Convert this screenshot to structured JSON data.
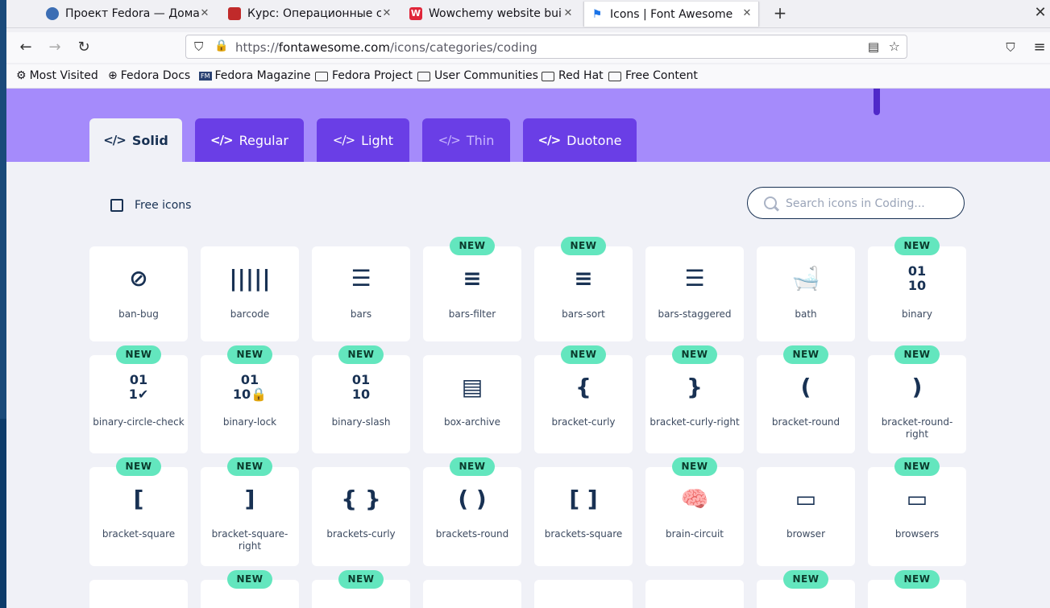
{
  "browser": {
    "tabs": [
      {
        "title": "Проект Fedora — Домашн",
        "favicon_color": "#3c6eb4"
      },
      {
        "title": "Курс: Операционные сис",
        "favicon_color": "#c02a2a"
      },
      {
        "title": "Wowchemy website build",
        "favicon_color": "#e0263a"
      },
      {
        "title": "Icons | Font Awesome",
        "favicon_color": "#1a73e8"
      }
    ],
    "new_tab": "+",
    "close_window": "✕",
    "url_scheme": "https://",
    "url_host": "fontawesome.com",
    "url_path": "/icons/categories/coding",
    "bookmarks": [
      "Most Visited",
      "Fedora Docs",
      "Fedora Magazine",
      "Fedora Project",
      "User Communities",
      "Red Hat",
      "Free Content"
    ]
  },
  "style_tabs": [
    "Solid",
    "Regular",
    "Light",
    "Thin",
    "Duotone"
  ],
  "code_glyph": "</>",
  "free_icons_label": "Free icons",
  "search_placeholder": "Search icons in Coding...",
  "badge_text": "NEW",
  "icons": [
    {
      "name": "ban-bug",
      "glyph": "⊘",
      "new": false
    },
    {
      "name": "barcode",
      "glyph": "|||||",
      "new": false
    },
    {
      "name": "bars",
      "glyph": "☰",
      "new": false
    },
    {
      "name": "bars-filter",
      "glyph": "≡",
      "new": true
    },
    {
      "name": "bars-sort",
      "glyph": "≡",
      "new": true
    },
    {
      "name": "bars-staggered",
      "glyph": "☰",
      "new": false
    },
    {
      "name": "bath",
      "glyph": "🛁",
      "new": false
    },
    {
      "name": "binary",
      "glyph": "01\n10",
      "new": true
    },
    {
      "name": "binary-circle-check",
      "glyph": "01\n1✔",
      "new": true
    },
    {
      "name": "binary-lock",
      "glyph": "01\n10🔒",
      "new": true
    },
    {
      "name": "binary-slash",
      "glyph": "01\n10",
      "new": true
    },
    {
      "name": "box-archive",
      "glyph": "▤",
      "new": false
    },
    {
      "name": "bracket-curly",
      "glyph": "{",
      "new": true
    },
    {
      "name": "bracket-curly-right",
      "glyph": "}",
      "new": true
    },
    {
      "name": "bracket-round",
      "glyph": "(",
      "new": true
    },
    {
      "name": "bracket-round-right",
      "glyph": ")",
      "new": true
    },
    {
      "name": "bracket-square",
      "glyph": "[",
      "new": true
    },
    {
      "name": "bracket-square-right",
      "glyph": "]",
      "new": true
    },
    {
      "name": "brackets-curly",
      "glyph": "{ }",
      "new": false
    },
    {
      "name": "brackets-round",
      "glyph": "( )",
      "new": true
    },
    {
      "name": "brackets-square",
      "glyph": "[ ]",
      "new": false
    },
    {
      "name": "brain-circuit",
      "glyph": "🧠",
      "new": true
    },
    {
      "name": "browser",
      "glyph": "▭",
      "new": false
    },
    {
      "name": "browsers",
      "glyph": "▭",
      "new": true
    },
    {
      "name": "",
      "glyph": "",
      "new": false
    },
    {
      "name": "",
      "glyph": "",
      "new": true
    },
    {
      "name": "",
      "glyph": "",
      "new": true
    },
    {
      "name": "",
      "glyph": "",
      "new": false
    },
    {
      "name": "",
      "glyph": "",
      "new": false
    },
    {
      "name": "",
      "glyph": "",
      "new": false
    },
    {
      "name": "",
      "glyph": "",
      "new": true
    },
    {
      "name": "",
      "glyph": "",
      "new": true
    }
  ]
}
